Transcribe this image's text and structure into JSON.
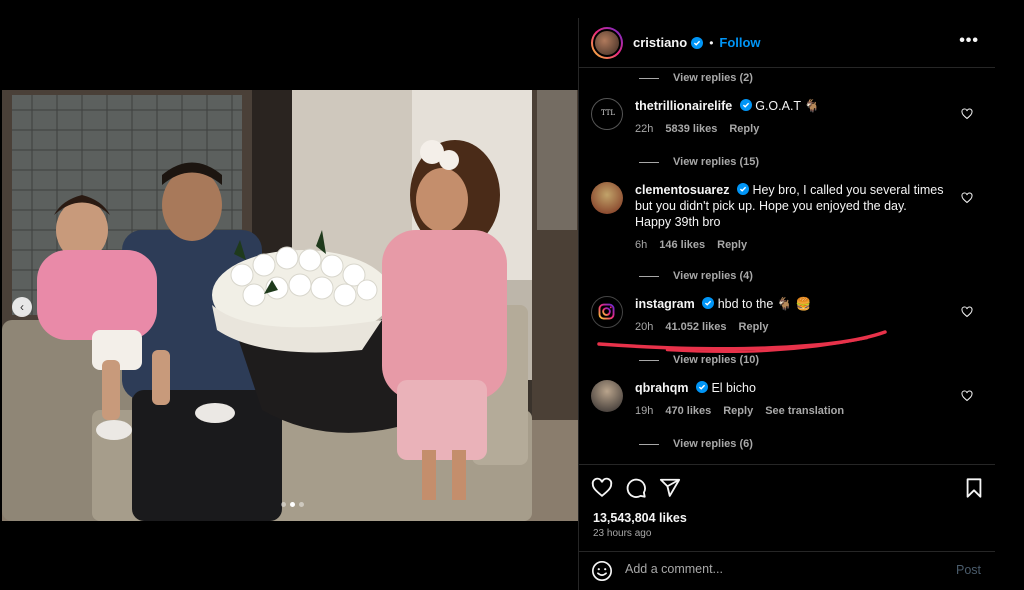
{
  "post": {
    "author": "cristiano",
    "follow_label": "Follow",
    "separator": "•",
    "more_label": "•••"
  },
  "comments": {
    "top_replies": "View replies (2)",
    "items": [
      {
        "username": "thetrillionairelife",
        "text": "G.O.A.T 🐐",
        "time": "22h",
        "likes": "5839 likes",
        "reply": "Reply",
        "replies": "View replies (15)",
        "avatar_label": "TTL"
      },
      {
        "username": "clementosuarez",
        "text": "Hey bro, I called you several times but you didn't pick up. Hope you enjoyed the day. Happy 39th bro",
        "time": "6h",
        "likes": "146 likes",
        "reply": "Reply",
        "replies": "View replies (4)"
      },
      {
        "username": "instagram",
        "text": "hbd to the 🐐 🍔",
        "time": "20h",
        "likes": "41.052 likes",
        "reply": "Reply",
        "replies": "View replies (10)"
      },
      {
        "username": "qbrahqm",
        "text": "El bicho",
        "time": "19h",
        "likes": "470 likes",
        "reply": "Reply",
        "translation": "See translation",
        "replies": "View replies (6)"
      }
    ]
  },
  "footer": {
    "likes": "13,543,804 likes",
    "time_ago": "23 hours ago",
    "comment_placeholder": "Add a comment...",
    "post_label": "Post"
  },
  "carousel": {
    "current": 2,
    "total": 3
  },
  "colors": {
    "accent": "#0095f6",
    "verified": "#0095f6",
    "annotation": "#e8324a",
    "muted": "#a8a8a8"
  }
}
